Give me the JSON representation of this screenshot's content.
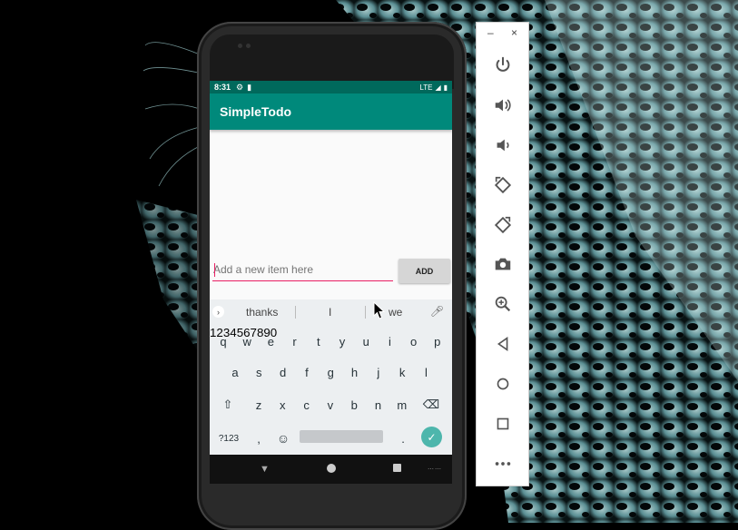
{
  "status_bar": {
    "time": "8:31",
    "network": "LTE"
  },
  "app": {
    "title": "SimpleTodo",
    "input_placeholder": "Add a new item here",
    "add_label": "ADD"
  },
  "keyboard": {
    "suggestions": [
      "thanks",
      "I",
      "we"
    ],
    "row1": [
      {
        "k": "q",
        "n": "1"
      },
      {
        "k": "w",
        "n": "2"
      },
      {
        "k": "e",
        "n": "3"
      },
      {
        "k": "r",
        "n": "4"
      },
      {
        "k": "t",
        "n": "5"
      },
      {
        "k": "y",
        "n": "6"
      },
      {
        "k": "u",
        "n": "7"
      },
      {
        "k": "i",
        "n": "8"
      },
      {
        "k": "o",
        "n": "9"
      },
      {
        "k": "p",
        "n": "0"
      }
    ],
    "row2": [
      "a",
      "s",
      "d",
      "f",
      "g",
      "h",
      "j",
      "k",
      "l"
    ],
    "row3": [
      "z",
      "x",
      "c",
      "v",
      "b",
      "n",
      "m"
    ],
    "symbols_label": "?123",
    "comma": ",",
    "period": "."
  },
  "emulator_panel": {
    "minimize": "–",
    "close": "×",
    "tools": [
      "power-icon",
      "volume-up-icon",
      "volume-down-icon",
      "rotate-left-icon",
      "rotate-right-icon",
      "camera-icon",
      "zoom-icon",
      "back-icon",
      "home-icon",
      "overview-icon",
      "more-icon"
    ]
  }
}
